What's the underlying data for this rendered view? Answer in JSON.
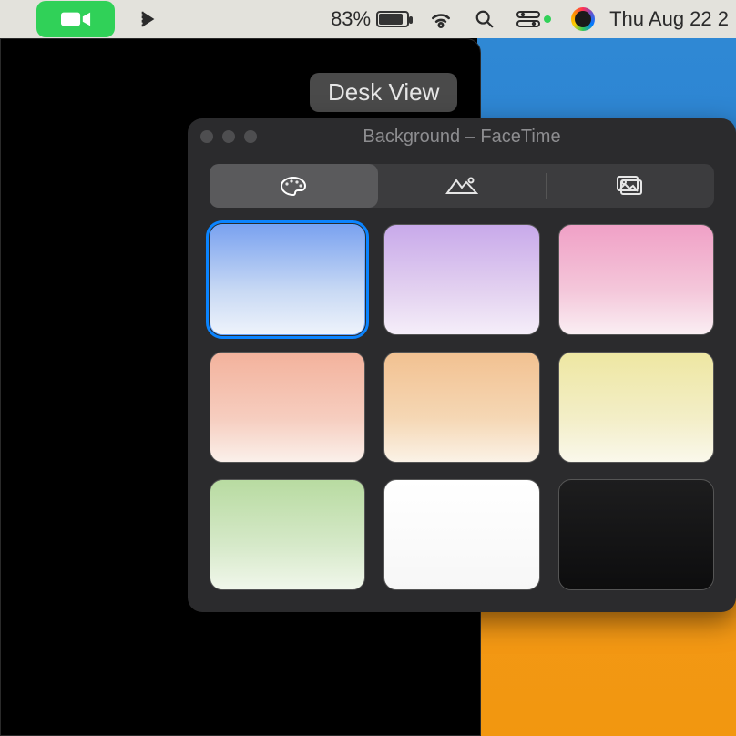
{
  "menubar": {
    "battery_percent": "83%",
    "clock": "Thu Aug 22  2"
  },
  "desk_view_label": "Desk View",
  "panel": {
    "title": "Background – FaceTime",
    "tabs": {
      "colors": "colors",
      "landscapes": "landscapes",
      "photos": "photos",
      "selected": "colors"
    },
    "swatches": [
      {
        "name": "blue",
        "css": "linear-gradient(180deg,#7aa2f0 0%, #c8d9f4 60%, #eef3fb 100%)",
        "selected": true
      },
      {
        "name": "purple",
        "css": "linear-gradient(180deg,#c8a9ea 0%, #e3d1f0 60%, #f5eef9 100%)",
        "selected": false
      },
      {
        "name": "pink",
        "css": "linear-gradient(180deg,#f0a0c6 0%, #f4c7da 60%, #faeef3 100%)",
        "selected": false
      },
      {
        "name": "coral",
        "css": "linear-gradient(180deg,#f3b29c 0%, #f6cdbf 60%, #fbf0ea 100%)",
        "selected": false
      },
      {
        "name": "orange",
        "css": "linear-gradient(180deg,#f2c191 0%, #f5d7b4 60%, #fbf2e6 100%)",
        "selected": false
      },
      {
        "name": "yellow",
        "css": "linear-gradient(180deg,#eee7a2 0%, #f3eec7 60%, #faf8eb 100%)",
        "selected": false
      },
      {
        "name": "green",
        "css": "linear-gradient(180deg,#b8dba1 0%, #d6e9c9 60%, #f1f7eb 100%)",
        "selected": false
      },
      {
        "name": "white",
        "css": "linear-gradient(180deg,#ffffff 0%, #f7f7f7 100%)",
        "selected": false
      },
      {
        "name": "black",
        "css": "linear-gradient(180deg,#1d1d1e 0%, #0d0d0e 100%)",
        "selected": false
      }
    ]
  }
}
